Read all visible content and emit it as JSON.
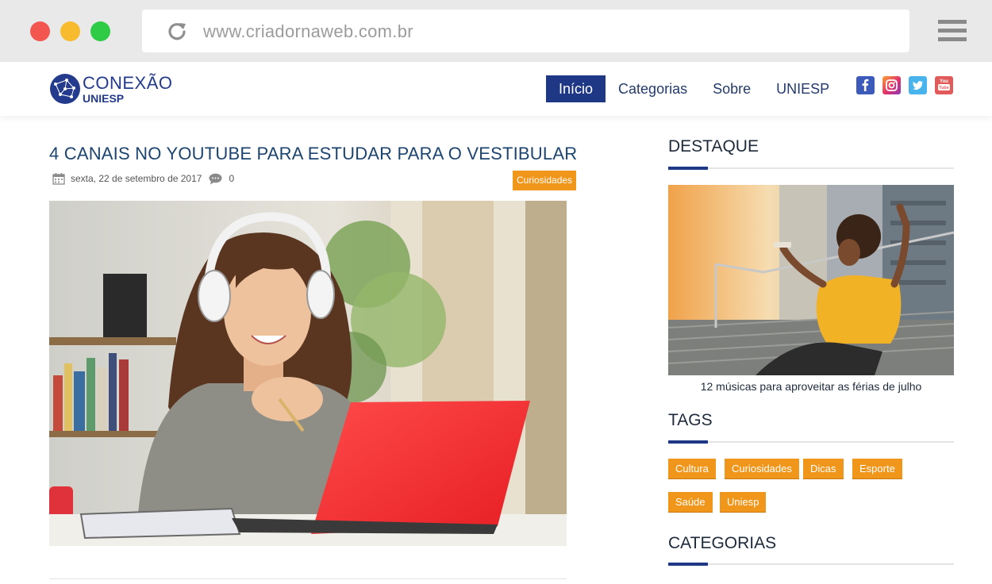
{
  "browser": {
    "url": "www.criadornaweb.com.br"
  },
  "site": {
    "logo_line1": "CONEXÃO",
    "logo_line2": "UNIESP",
    "nav": [
      {
        "label": "Início",
        "active": true
      },
      {
        "label": "Categorias",
        "active": false
      },
      {
        "label": "Sobre",
        "active": false
      },
      {
        "label": "UNIESP",
        "active": false
      }
    ],
    "social": [
      "facebook-icon",
      "instagram-icon",
      "twitter-icon",
      "youtube-icon"
    ],
    "accent_color": "#1f3886",
    "badge_color": "#f0961a"
  },
  "post": {
    "title": "4 CANAIS NO YOUTUBE PARA ESTUDAR PARA O VESTIBULAR",
    "date": "sexta, 22 de setembro de 2017",
    "comments": "0",
    "category": "Curiosidades",
    "image_alt": "woman with headphones using red laptop"
  },
  "sidebar": {
    "featured_title": "DESTAQUE",
    "featured_caption": "12 músicas para aproveitar as férias de julho",
    "tags_title": "TAGS",
    "tags": [
      "Cultura",
      "Curiosidades",
      "Dicas",
      "Esporte",
      "Saúde",
      "Uniesp"
    ],
    "categories_title": "CATEGORIAS"
  }
}
